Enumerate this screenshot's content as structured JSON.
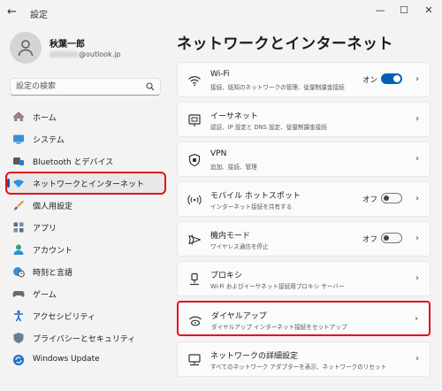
{
  "window": {
    "title": "設定",
    "back_glyph": "←",
    "minimize_glyph": "—",
    "maximize_glyph": "☐",
    "close_glyph": "✕"
  },
  "user": {
    "name": "秋葉一郎",
    "email_suffix": "@outlook.jp"
  },
  "search": {
    "placeholder": "設定の検索"
  },
  "nav": {
    "items": [
      {
        "label": "ホーム",
        "icon": "home-icon"
      },
      {
        "label": "システム",
        "icon": "system-icon"
      },
      {
        "label": "Bluetooth とデバイス",
        "icon": "bluetooth-icon"
      },
      {
        "label": "ネットワークとインターネット",
        "icon": "network-icon",
        "selected": true
      },
      {
        "label": "個人用設定",
        "icon": "brush-icon"
      },
      {
        "label": "アプリ",
        "icon": "apps-icon"
      },
      {
        "label": "アカウント",
        "icon": "account-icon"
      },
      {
        "label": "時刻と言語",
        "icon": "globe-clock-icon"
      },
      {
        "label": "ゲーム",
        "icon": "gamepad-icon"
      },
      {
        "label": "アクセシビリティ",
        "icon": "accessibility-icon"
      },
      {
        "label": "プライバシーとセキュリティ",
        "icon": "shield-icon"
      },
      {
        "label": "Windows Update",
        "icon": "update-icon"
      }
    ]
  },
  "main": {
    "title": "ネットワークとインターネット",
    "cards": [
      {
        "title": "Wi-Fi",
        "desc": "接続、既知のネットワークの管理、従量制課金接続",
        "state": "オン",
        "toggle": "on",
        "icon": "wifi-icon"
      },
      {
        "title": "イーサネット",
        "desc": "認証、IP 設定と DNS 設定、従量制課金接続",
        "icon": "ethernet-icon"
      },
      {
        "title": "VPN",
        "desc": "追加、接続、管理",
        "icon": "vpn-shield-icon"
      },
      {
        "title": "モバイル ホットスポット",
        "desc": "インターネット接続を共有する",
        "state": "オフ",
        "toggle": "off",
        "icon": "hotspot-icon"
      },
      {
        "title": "機内モード",
        "desc": "ワイヤレス通信を停止",
        "state": "オフ",
        "toggle": "off",
        "icon": "airplane-icon"
      },
      {
        "title": "プロキシ",
        "desc": "Wi-Fi およびイーサネット接続用プロキシ サーバー",
        "icon": "proxy-icon"
      },
      {
        "title": "ダイヤルアップ",
        "desc": "ダイヤルアップ インターネット接続をセットアップ",
        "icon": "dialup-icon"
      },
      {
        "title": "ネットワークの詳細設定",
        "desc": "すべてのネットワーク アダプターを表示、ネットワークのリセット",
        "icon": "advanced-network-icon"
      }
    ],
    "chevron": "›"
  },
  "colors": {
    "accent": "#005fb8",
    "highlight": "#e1121b"
  }
}
